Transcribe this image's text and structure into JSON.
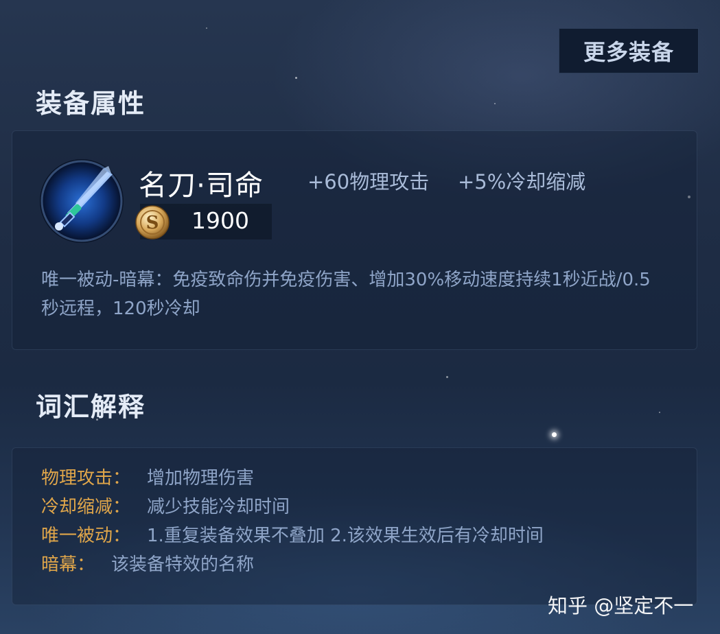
{
  "header": {
    "more_button": "更多装备",
    "attributes_title": "装备属性",
    "glossary_title": "词汇解释"
  },
  "item": {
    "name": "名刀·司命",
    "stats": [
      "+60物理攻击",
      "+5%冷却缩减"
    ],
    "price": "1900",
    "description": "唯一被动-暗幕：免疫致命伤并免疫伤害、增加30%移动速度持续1秒近战/0.5秒远程，120秒冷却",
    "icon": "sword-icon",
    "currency_icon": "gold-coin-icon"
  },
  "glossary": [
    {
      "term": "物理攻击：",
      "definition": "增加物理伤害"
    },
    {
      "term": "冷却缩减：",
      "definition": "减少技能冷却时间"
    },
    {
      "term": "唯一被动：",
      "definition": "1.重复装备效果不叠加 2.该效果生效后有冷却时间"
    },
    {
      "term": "暗幕：",
      "definition": "该装备特效的名称"
    }
  ],
  "watermark": "知乎 @坚定不一",
  "colors": {
    "term": "#e0a64a",
    "definition": "#8fa5c8",
    "background": "#1f2d45"
  }
}
